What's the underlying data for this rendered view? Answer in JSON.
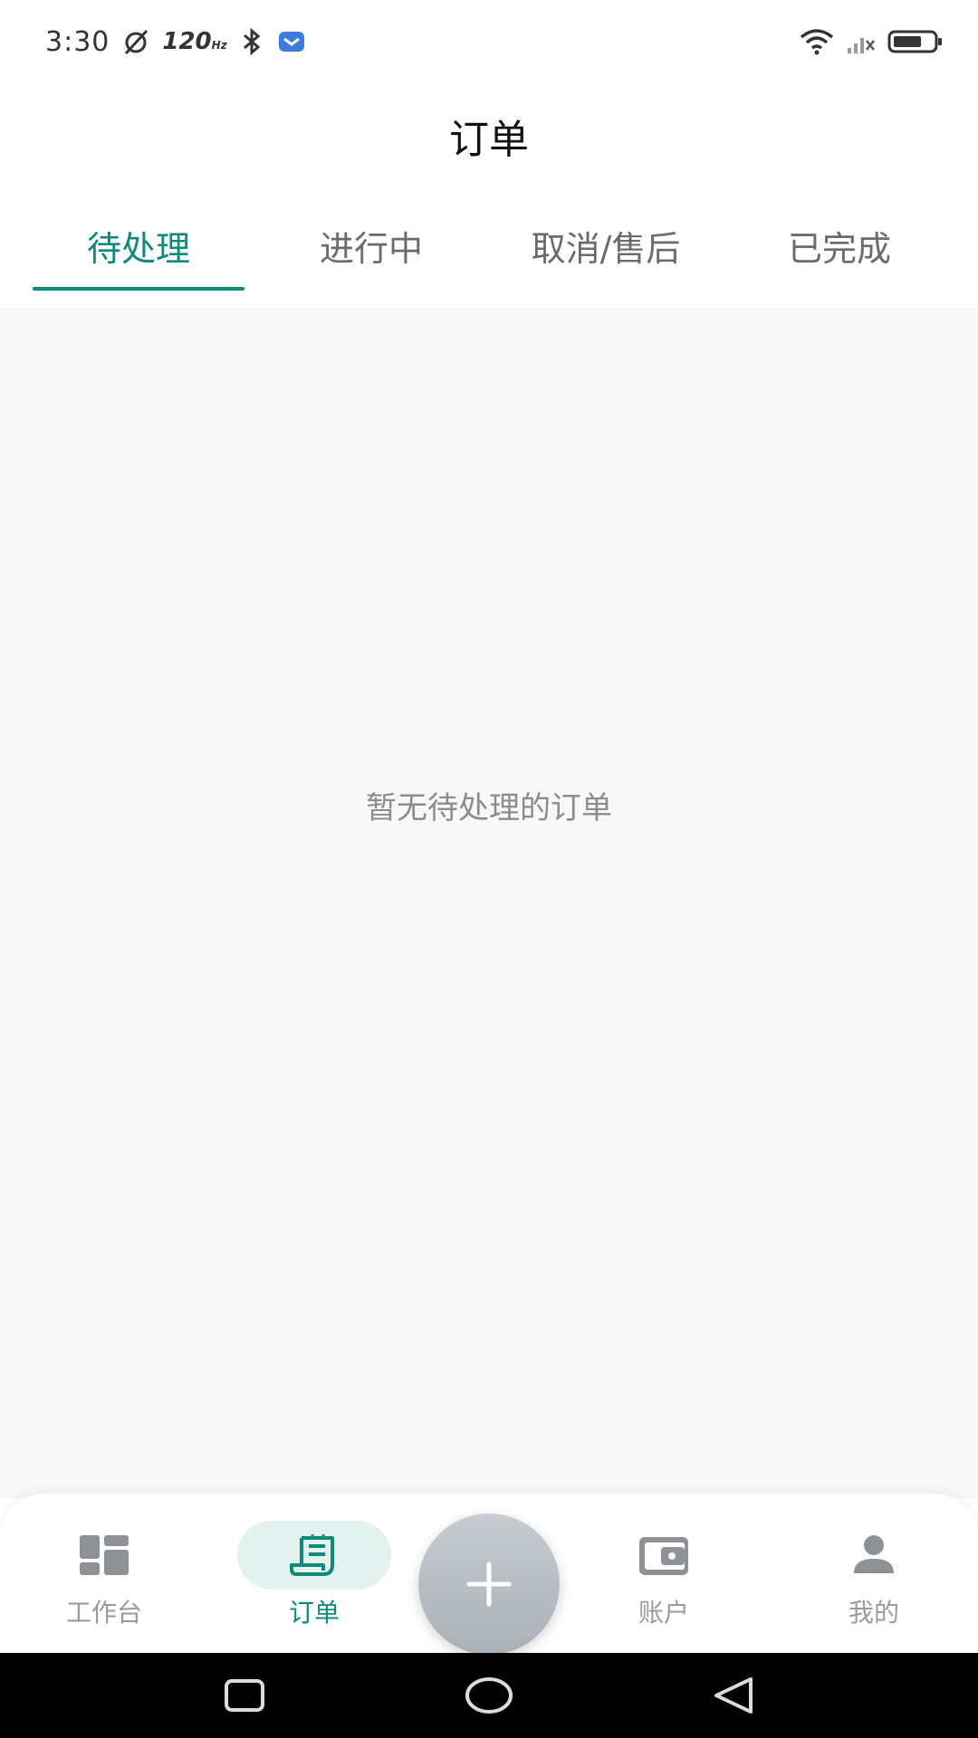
{
  "status_bar": {
    "time": "3:30",
    "refresh_rate": "120",
    "refresh_unit": "Hz",
    "icons": [
      "alarm-off-icon",
      "bluetooth-icon",
      "app-notification-icon",
      "wifi-icon",
      "signal-icon",
      "battery-icon"
    ]
  },
  "header": {
    "title": "订单"
  },
  "tabs": [
    {
      "label": "待处理",
      "active": true
    },
    {
      "label": "进行中",
      "active": false
    },
    {
      "label": "取消/售后",
      "active": false
    },
    {
      "label": "已完成",
      "active": false
    }
  ],
  "content": {
    "empty_message": "暂无待处理的订单"
  },
  "bottom_nav": {
    "items": [
      {
        "label": "工作台",
        "icon": "dashboard-icon",
        "active": false
      },
      {
        "label": "订单",
        "icon": "order-list-icon",
        "active": true
      },
      {
        "label": "账户",
        "icon": "wallet-icon",
        "active": false
      },
      {
        "label": "我的",
        "icon": "person-icon",
        "active": false
      }
    ],
    "fab_icon": "plus-icon"
  },
  "system_nav": {
    "icons": [
      "recent-apps-icon",
      "home-icon",
      "back-icon"
    ]
  },
  "colors": {
    "accent": "#0d8a78",
    "inactive": "#9b9b9b",
    "content_bg": "#f8f8f8"
  }
}
